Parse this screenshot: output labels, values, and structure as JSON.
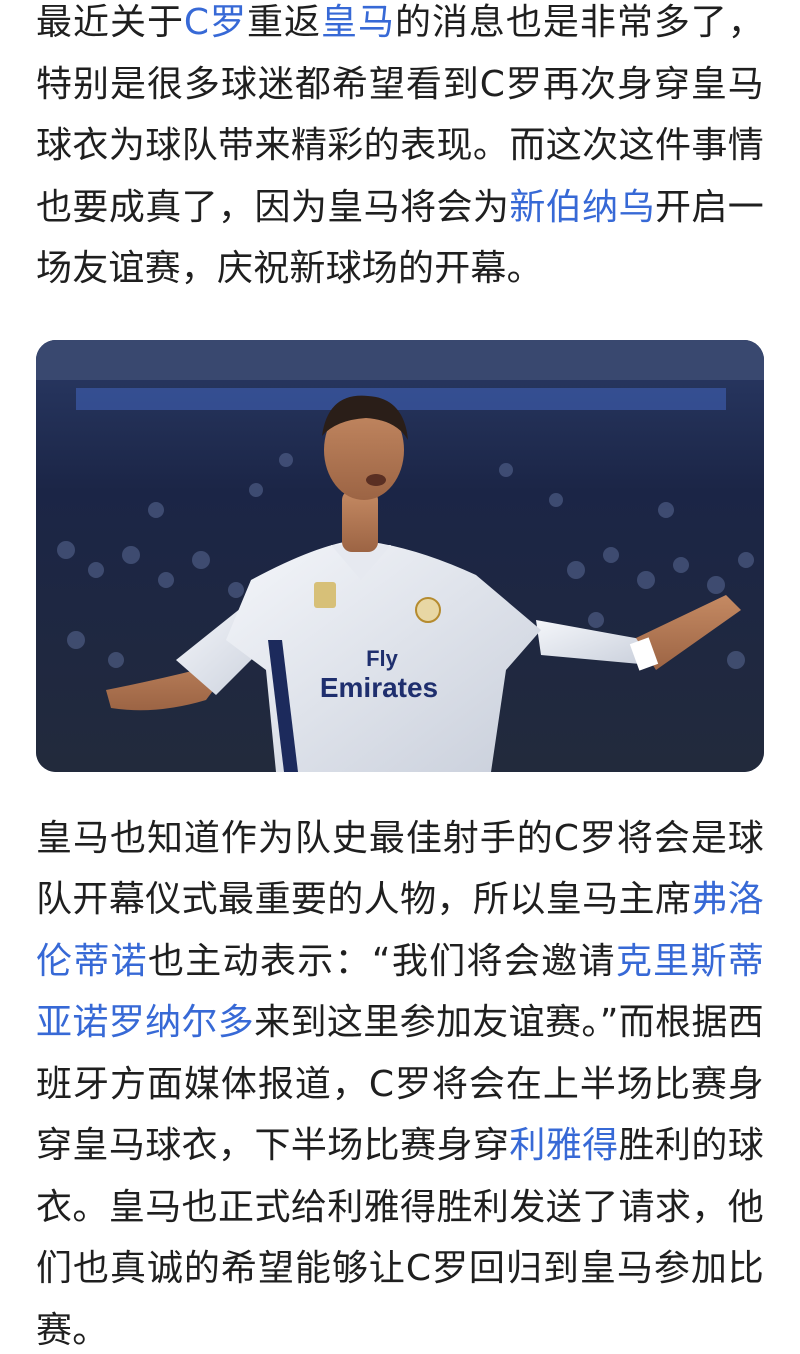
{
  "paragraph1": {
    "seg1": "最近关于",
    "link1": "C罗",
    "seg2": "重返",
    "link2": "皇马",
    "seg3": "的消息也是非常多了，特别是很多球迷都希望看到C罗再次身穿皇马球衣为球队带来精彩的表现。而这次这件事情也要成真了，因为皇马将会为",
    "link3": "新伯纳乌",
    "seg4": "开启一场友谊赛，庆祝新球场的开幕。"
  },
  "photo": {
    "icon": "football-player-photo",
    "jersey_text_line1": "Fly",
    "jersey_text_line2": "Emirates"
  },
  "paragraph2": {
    "seg1": "皇马也知道作为队史最佳射手的C罗将会是球队开幕仪式最重要的人物，所以皇马主席",
    "link1": "弗洛伦蒂诺",
    "seg2": "也主动表示：“我们将会邀请",
    "link2": "克里斯蒂亚诺罗纳尔多",
    "seg3": "来到这里参加友谊赛。”而根据西班牙方面媒体报道，C罗将会在上半场比赛身穿皇马球衣，下半场比赛身穿",
    "link3": "利雅得",
    "seg4": "胜利的球衣。皇马也正式给利雅得胜利发送了请求，他们也真诚的希望能够让C罗回归到皇马参加比赛。"
  },
  "colors": {
    "text": "#1f1f1f",
    "link": "#3769d6",
    "background": "#ffffff"
  }
}
